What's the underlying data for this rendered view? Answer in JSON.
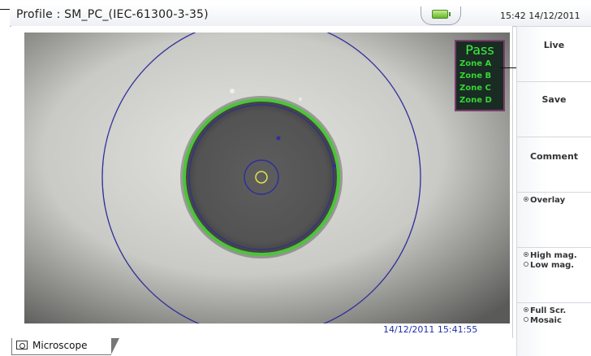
{
  "header": {
    "profile": "Profile : SM_PC_(IEC-61300-3-35)",
    "clock": "15:42  14/12/2011",
    "battery_icon": "battery-icon"
  },
  "result": {
    "status": "Pass",
    "zones": [
      "Zone A",
      "Zone B",
      "Zone C",
      "Zone D"
    ],
    "status_color": "#3df33d"
  },
  "image": {
    "timestamp": "14/12/2011 15:41:55"
  },
  "tabs": [
    {
      "label": "Microscope",
      "icon": "camera-icon"
    }
  ],
  "sidebar": {
    "live_label": "Live",
    "save_label": "Save",
    "comment_label": "Comment",
    "overlay_label": "Overlay",
    "overlay_on": true,
    "magnification": {
      "options": [
        "High mag.",
        "Low mag."
      ],
      "selected": "High mag."
    },
    "view_mode": {
      "options": [
        "Full Scr.",
        "Mosaic"
      ],
      "selected": "Full Scr."
    }
  },
  "colors": {
    "zone_ring": "#2f2f9c",
    "fiber_ring": "#4cc43a",
    "timestamp": "#1f2fa8"
  }
}
